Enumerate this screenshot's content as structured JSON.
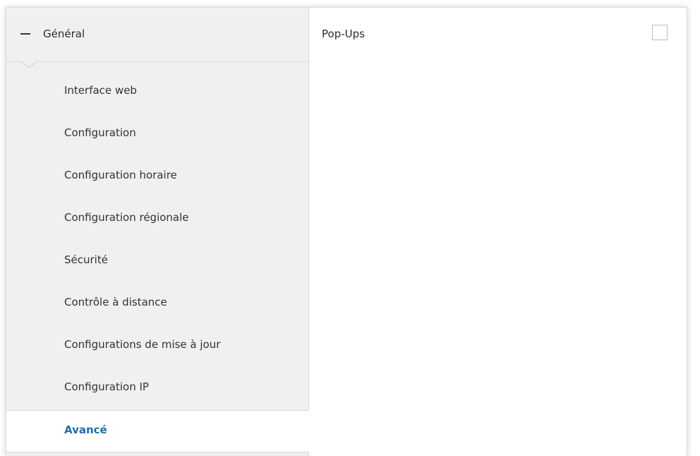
{
  "sidebar": {
    "group": {
      "label": "Général",
      "icon": "minus-icon"
    },
    "items": [
      {
        "label": "Interface web"
      },
      {
        "label": "Configuration"
      },
      {
        "label": "Configuration horaire"
      },
      {
        "label": "Configuration régionale"
      },
      {
        "label": "Sécurité"
      },
      {
        "label": "Contrôle à distance"
      },
      {
        "label": "Configurations de mise à jour"
      },
      {
        "label": "Configuration IP"
      },
      {
        "label": "Avancé",
        "active": true
      }
    ]
  },
  "content": {
    "popups": {
      "label": "Pop-Ups",
      "checked": false
    }
  },
  "colors": {
    "active_text": "#1f6fb2",
    "sidebar_bg": "#f0f0f0"
  }
}
